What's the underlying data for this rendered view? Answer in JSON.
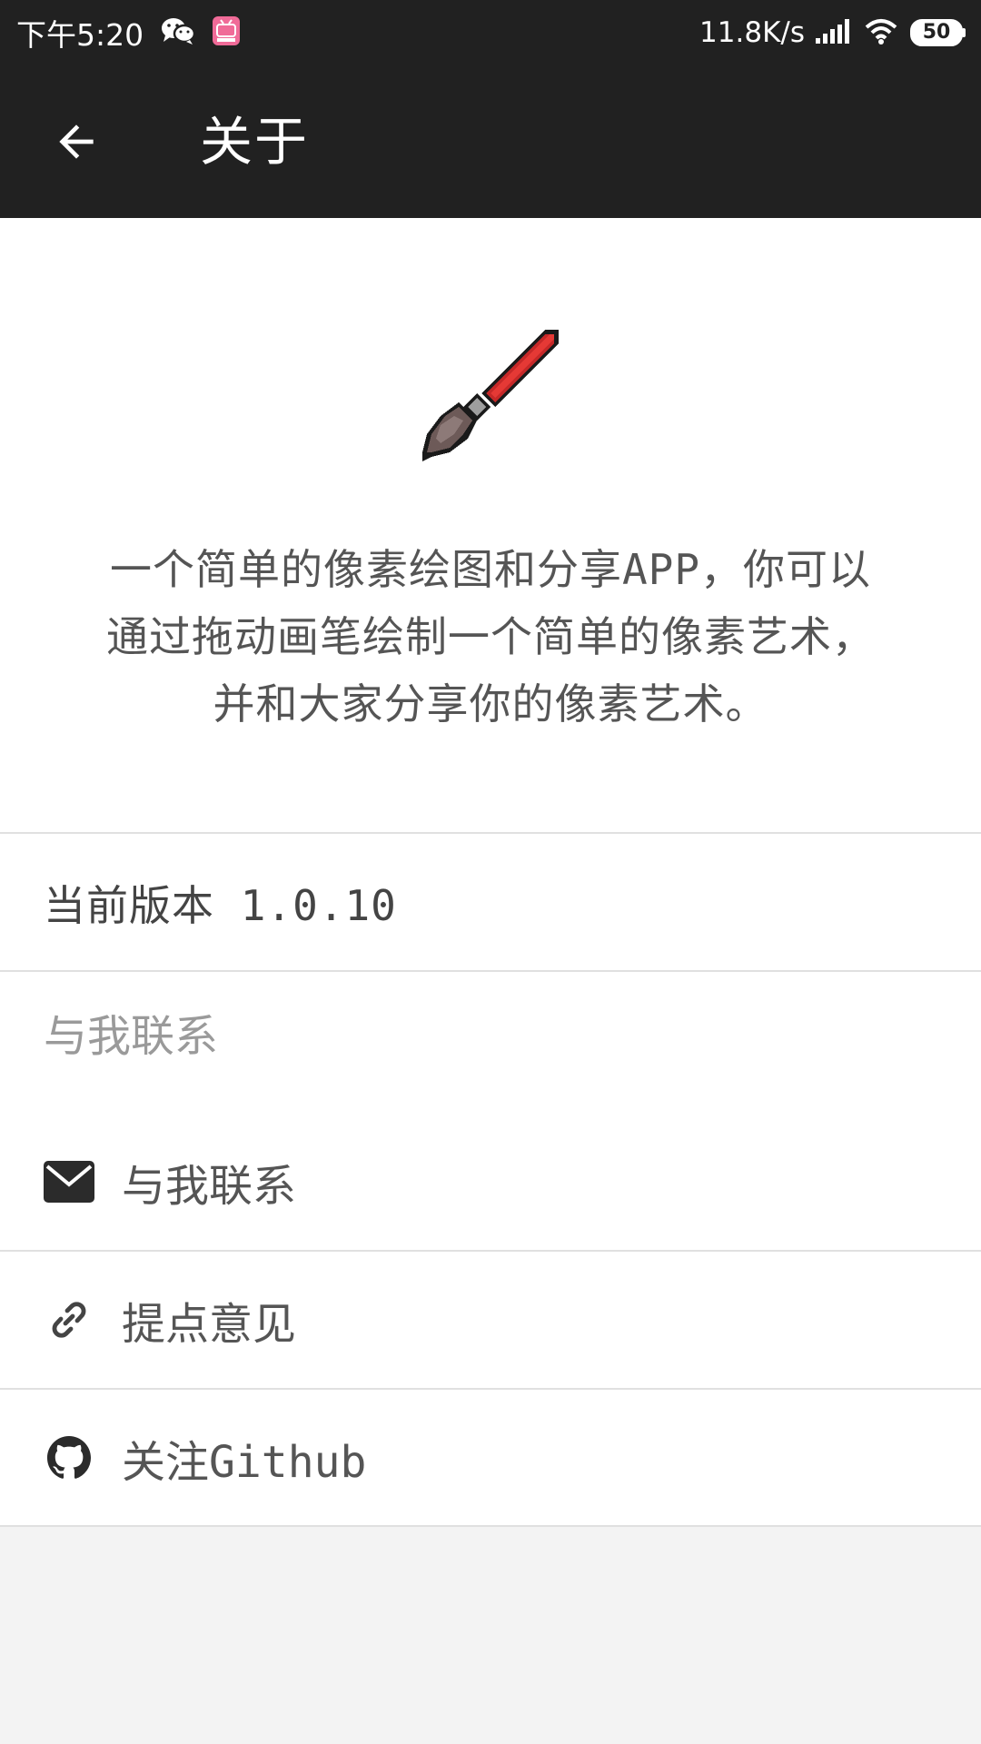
{
  "status_bar": {
    "time": "下午5:20",
    "net_speed": "11.8K/s",
    "battery": "50",
    "icons": [
      "wechat-icon",
      "bilibili-icon",
      "signal-icon",
      "wifi-icon",
      "battery-icon"
    ]
  },
  "app_bar": {
    "back_icon": "arrow-back-icon",
    "title": "关于"
  },
  "about": {
    "logo_icon": "pixel-brush-icon",
    "intro_lines": [
      "一个简单的像素绘图和分享APP，你可以",
      "通过拖动画笔绘制一个简单的像素艺术，",
      "并和大家分享你的像素艺术。"
    ]
  },
  "version": {
    "label": "当前版本 1.0.10"
  },
  "contact_section": {
    "header": "与我联系",
    "items": [
      {
        "icon": "mail-icon",
        "label": "与我联系"
      },
      {
        "icon": "link-icon",
        "label": "提点意见"
      },
      {
        "icon": "github-icon",
        "label": "关注Github"
      }
    ]
  },
  "colors": {
    "app_bar": "#212121",
    "content_bg": "#ffffff",
    "page_bg": "#f3f3f3",
    "text": "#555555",
    "muted": "#9a9a9a",
    "divider": "#e0e0e0",
    "brush_red": "#c62828"
  }
}
